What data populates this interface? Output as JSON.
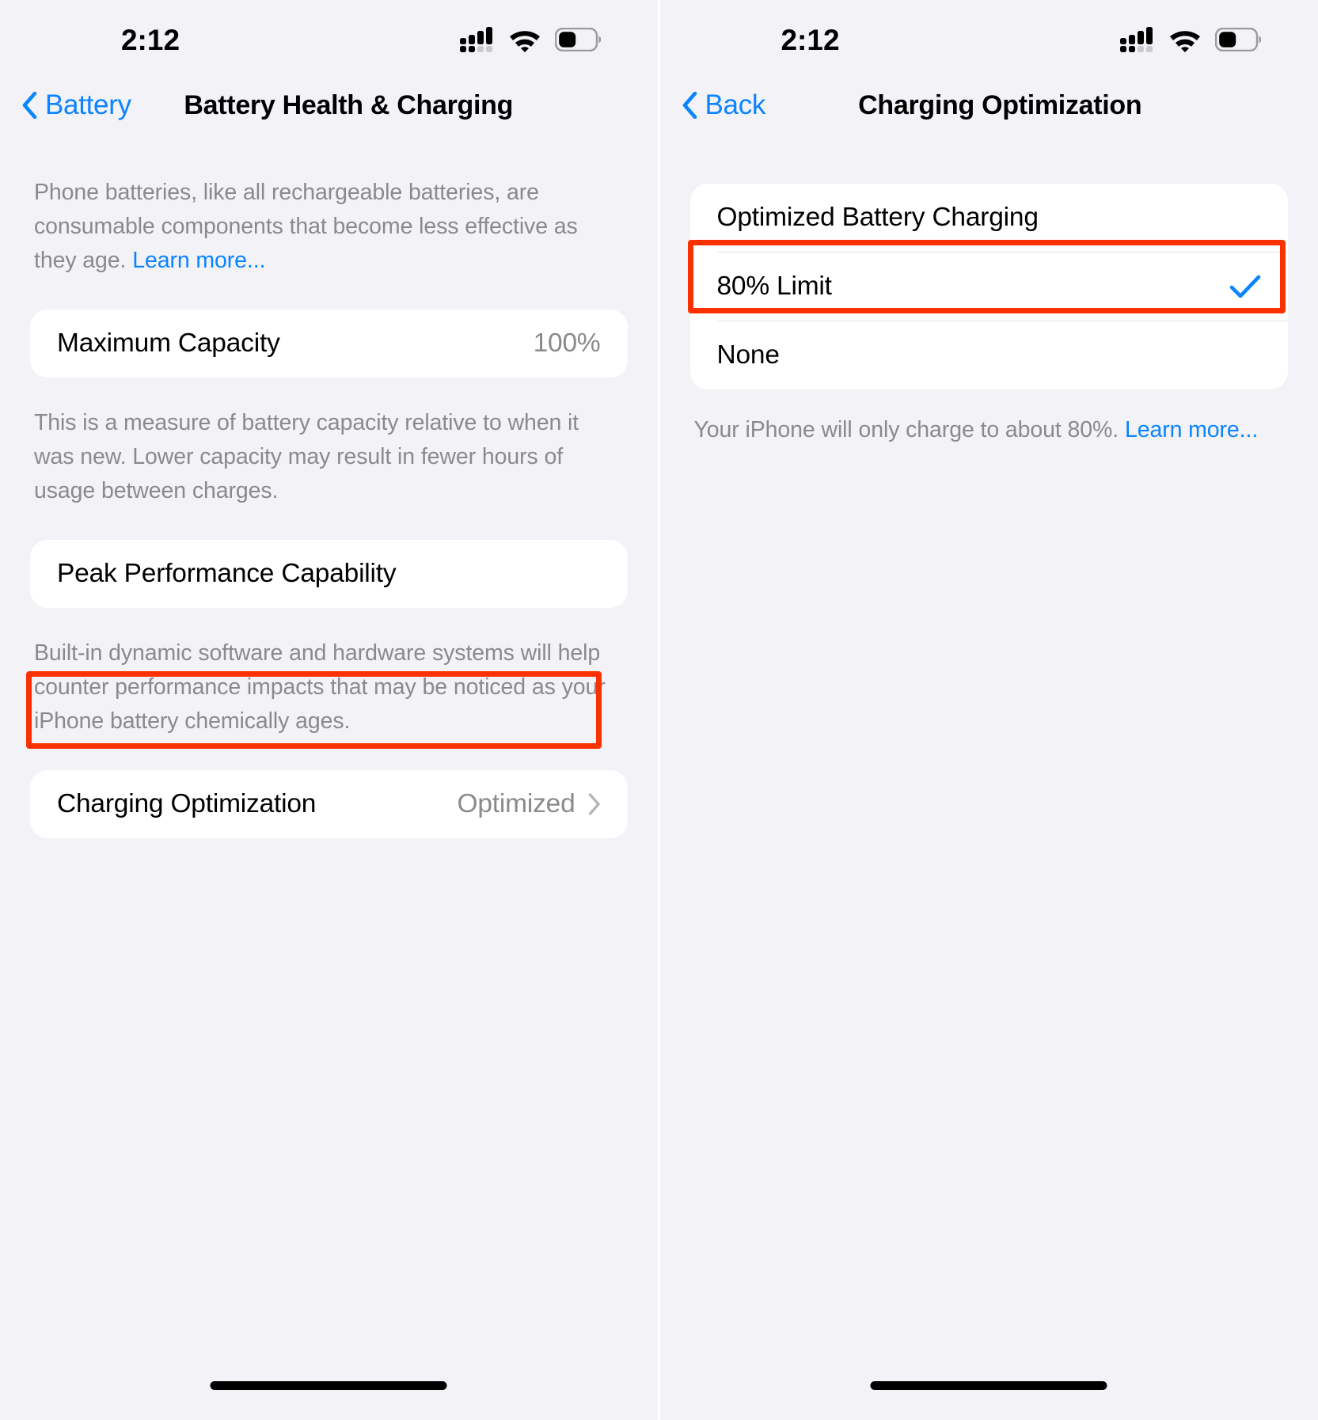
{
  "colors": {
    "accent": "#0a84ff",
    "highlight": "#fa3100",
    "page_bg": "#f2f2f7",
    "card_bg": "#ffffff",
    "secondary_text": "#8a8a8e"
  },
  "left_screen": {
    "status": {
      "time": "2:12",
      "cellular_icon": "cellular-signal-icon",
      "wifi_icon": "wifi-icon",
      "battery_icon": "battery-icon"
    },
    "nav": {
      "back_label": "Battery",
      "back_icon": "chevron-left-icon",
      "title": "Battery Health & Charging"
    },
    "intro_text": "Phone batteries, like all rechargeable batteries, are consumable components that become less effective as they age. ",
    "intro_link": "Learn more...",
    "max_capacity": {
      "label": "Maximum Capacity",
      "value": "100%"
    },
    "max_capacity_footnote": "This is a measure of battery capacity relative to when it was new. Lower capacity may result in fewer hours of usage between charges.",
    "peak_performance": {
      "label": "Peak Performance Capability"
    },
    "peak_performance_footnote": "Built-in dynamic software and hardware systems will help counter performance impacts that may be noticed as your iPhone battery chemically ages.",
    "charging_optimization": {
      "label": "Charging Optimization",
      "value": "Optimized",
      "disclosure_icon": "chevron-right-icon"
    }
  },
  "right_screen": {
    "status": {
      "time": "2:12",
      "cellular_icon": "cellular-signal-icon",
      "wifi_icon": "wifi-icon",
      "battery_icon": "battery-icon"
    },
    "nav": {
      "back_label": "Back",
      "back_icon": "chevron-left-icon",
      "title": "Charging Optimization"
    },
    "options": [
      {
        "label": "Optimized Battery Charging",
        "selected": false
      },
      {
        "label": "80% Limit",
        "selected": true
      },
      {
        "label": "None",
        "selected": false
      }
    ],
    "checkmark_icon": "checkmark-icon",
    "footnote_text": "Your iPhone will only charge to about 80%. ",
    "footnote_link": "Learn more..."
  }
}
